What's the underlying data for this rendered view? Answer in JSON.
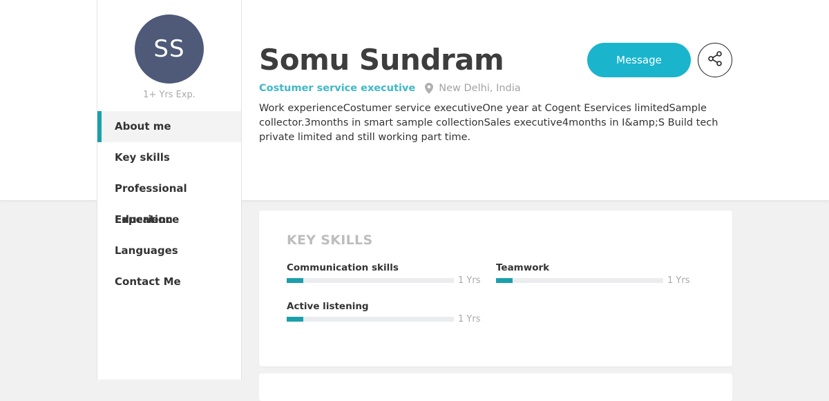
{
  "profile": {
    "initials": "SS",
    "experience": "1+ Yrs Exp.",
    "name": "Somu Sundram",
    "role": "Costumer service executive",
    "location": "New Delhi, India",
    "description": "Work experienceCostumer service executiveOne year at Cogent Eservices limitedSample collector.3months in smart sample collectionSales executive4months in I&amp;S Build tech private limited and still working part time."
  },
  "sidebar": {
    "items": [
      {
        "label": "About me",
        "active": true
      },
      {
        "label": "Key skills",
        "active": false
      },
      {
        "label": "Professional Experience",
        "active": false
      },
      {
        "label": "Education",
        "active": false
      },
      {
        "label": "Languages",
        "active": false
      },
      {
        "label": "Contact Me",
        "active": false
      }
    ]
  },
  "actions": {
    "message_label": "Message",
    "share_icon": "share-icon"
  },
  "key_skills": {
    "title": "KEY SKILLS",
    "skills": [
      {
        "name": "Communication skills",
        "years": "1 Yrs",
        "level": 0.1
      },
      {
        "name": "Teamwork",
        "years": "1 Yrs",
        "level": 0.1
      },
      {
        "name": "Active listening",
        "years": "1 Yrs",
        "level": 0.1
      }
    ]
  },
  "colors": {
    "accent": "#1a9fab",
    "button": "#1ab5cc",
    "role_text": "#3fb8c8",
    "avatar_bg": "#4e5a78"
  }
}
